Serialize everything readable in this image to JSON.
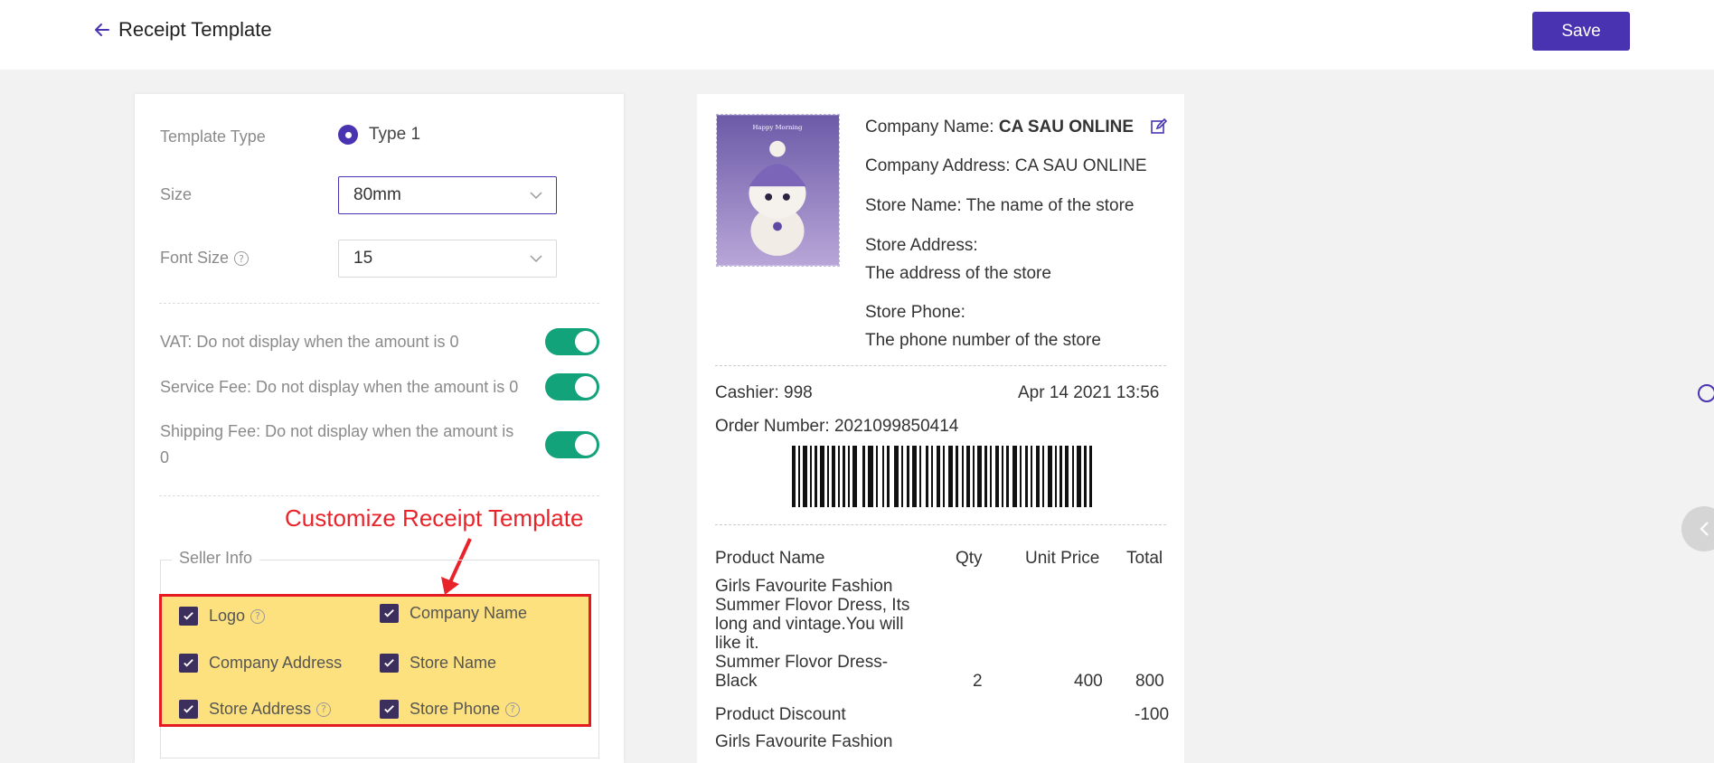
{
  "header": {
    "title": "Receipt Template",
    "save_label": "Save",
    "brand_color": "#4a33b0"
  },
  "settings": {
    "template_type_label": "Template Type",
    "template_type_value": "Type 1",
    "size_label": "Size",
    "size_value": "80mm",
    "font_size_label": "Font Size",
    "font_size_value": "15",
    "toggles": [
      {
        "label": "VAT: Do not display when the amount is 0",
        "on": true
      },
      {
        "label": "Service Fee: Do not display when the amount is 0",
        "on": true
      },
      {
        "label_line1": "Shipping Fee: Do not display when the amount is",
        "label_line2": "0",
        "on": true
      }
    ],
    "toggle_color": "#12a37a",
    "annotation": "Customize Receipt Template",
    "seller_info_label": "Seller Info",
    "checkboxes": [
      {
        "label": "Logo",
        "checked": true,
        "help": true
      },
      {
        "label": "Company Name",
        "checked": true,
        "help": false
      },
      {
        "label": "Company Address",
        "checked": true,
        "help": false
      },
      {
        "label": "Store Name",
        "checked": true,
        "help": false
      },
      {
        "label": "Store Address",
        "checked": true,
        "help": true
      },
      {
        "label": "Store Phone",
        "checked": true,
        "help": true
      }
    ]
  },
  "receipt": {
    "logo_caption": "Happy Morning",
    "company_name_label": "Company Name: ",
    "company_name_value": "CA SAU ONLINE",
    "company_address": "Company Address: CA SAU ONLINE",
    "store_name": "Store Name: The name of the store",
    "store_address_label": "Store Address:",
    "store_address_value": "The address of the store",
    "store_phone_label": "Store Phone:",
    "store_phone_value": "The phone number of the store",
    "cashier": "Cashier: 998",
    "datetime": "Apr 14 2021 13:56",
    "order_number": "Order Number: 2021099850414",
    "table_headers": [
      "Product Name",
      "Qty",
      "Unit Price",
      "Total"
    ],
    "items": [
      {
        "name_lines": [
          "Girls Favourite Fashion",
          "Summer Flovor Dress, Its",
          "long and vintage.You will",
          "like it.",
          "Summer Flovor Dress-",
          "Black"
        ],
        "qty": "2",
        "unit_price": "400",
        "total": "800"
      }
    ],
    "discount_label": "Product Discount",
    "discount_value": "-100",
    "next_item_partial": "Girls Favourite Fashion"
  }
}
